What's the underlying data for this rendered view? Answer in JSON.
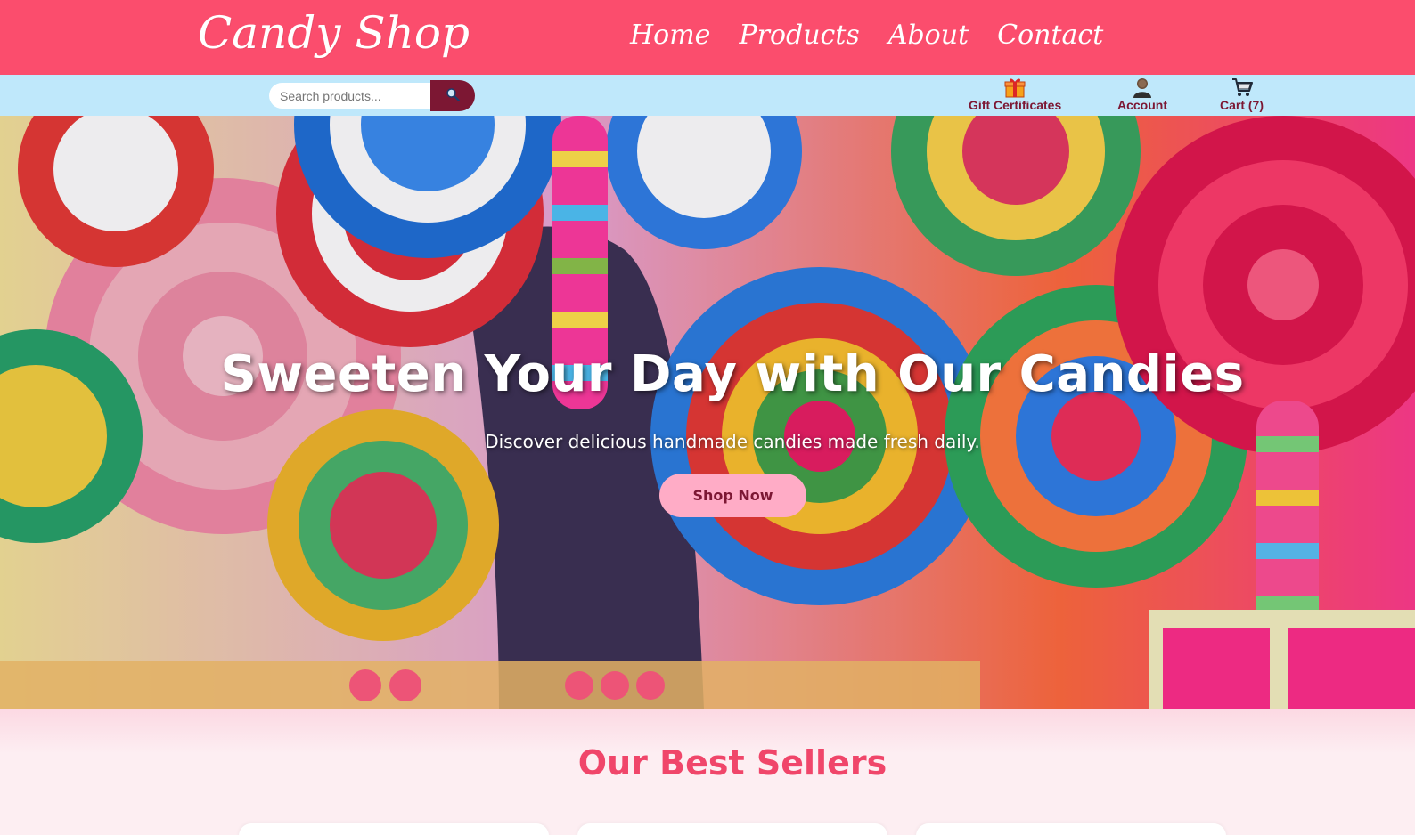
{
  "header": {
    "logo": "Candy Shop",
    "nav": [
      "Home",
      "Products",
      "About",
      "Contact"
    ]
  },
  "subbar": {
    "search_placeholder": "Search products...",
    "gift_label": "Gift Certificates",
    "account_label": "Account",
    "cart_label": "Cart (7)"
  },
  "hero": {
    "title": "Sweeten Your Day with Our Candies",
    "subtitle": "Discover delicious handmade candies made fresh daily.",
    "button": "Shop Now"
  },
  "best_sellers": {
    "heading": "Our Best Sellers"
  },
  "colors": {
    "brand": "#fb4d6d",
    "subbar": "#bfe8fb",
    "accent_dark": "#7c1733",
    "button": "#ffacc6"
  }
}
